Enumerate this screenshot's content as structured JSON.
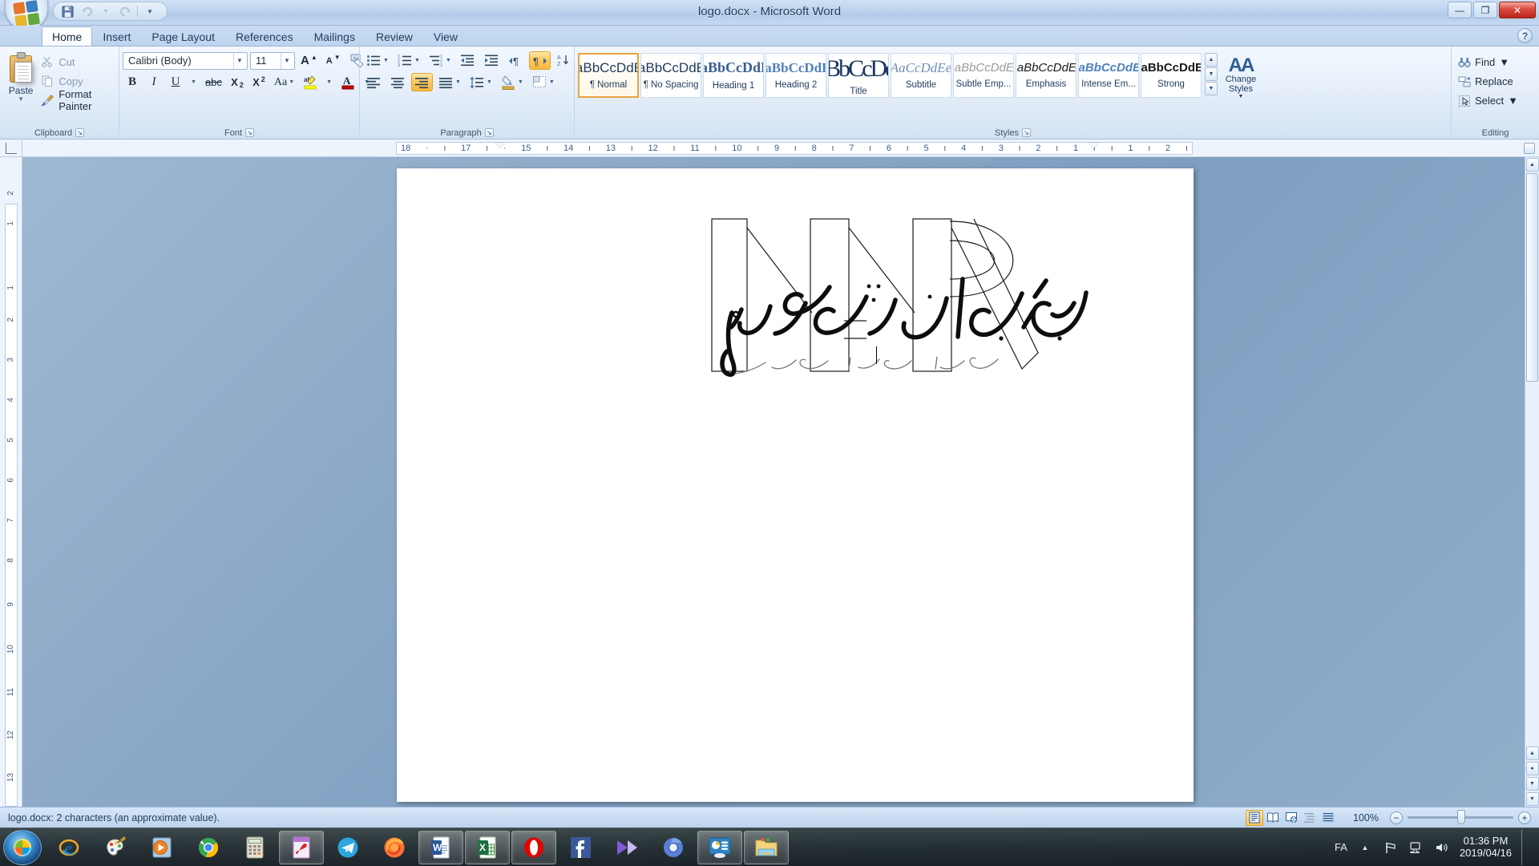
{
  "window": {
    "title": "logo.docx - Microsoft Word",
    "office_button": "office-orb",
    "quick_access": [
      {
        "name": "save",
        "icon": "save-icon",
        "label": "Save"
      },
      {
        "name": "undo",
        "icon": "undo-icon",
        "label": "Undo"
      },
      {
        "name": "undo-dropdown",
        "icon": "chevron-down-icon",
        "label": ""
      },
      {
        "name": "redo",
        "icon": "redo-icon",
        "label": "Redo"
      },
      {
        "name": "customize",
        "icon": "chevron-down-icon",
        "label": ""
      }
    ],
    "controls": [
      {
        "name": "minimize",
        "glyph": "—"
      },
      {
        "name": "maximize",
        "glyph": "❐"
      },
      {
        "name": "close",
        "glyph": "✕"
      }
    ],
    "help_glyph": "?"
  },
  "tabs": [
    {
      "label": "Home",
      "active": true
    },
    {
      "label": "Insert",
      "active": false
    },
    {
      "label": "Page Layout",
      "active": false
    },
    {
      "label": "References",
      "active": false
    },
    {
      "label": "Mailings",
      "active": false
    },
    {
      "label": "Review",
      "active": false
    },
    {
      "label": "View",
      "active": false
    }
  ],
  "ribbon": {
    "clipboard": {
      "label": "Clipboard",
      "paste_label": "Paste",
      "items": [
        {
          "label": "Cut",
          "icon": "scissors-icon",
          "enabled": false
        },
        {
          "label": "Copy",
          "icon": "copy-icon",
          "enabled": false
        },
        {
          "label": "Format Painter",
          "icon": "paintbrush-icon",
          "enabled": true
        }
      ]
    },
    "font": {
      "label": "Font",
      "font_name": "Calibri (Body)",
      "font_size": "11",
      "buttons": [
        {
          "name": "grow-font",
          "glyph": "A",
          "label": "Grow Font"
        },
        {
          "name": "shrink-font",
          "glyph": "A",
          "label": "Shrink Font"
        },
        {
          "name": "clear-formatting",
          "glyph": "Aa",
          "label": "Clear Formatting"
        },
        {
          "name": "bold",
          "glyph": "B",
          "label": "Bold"
        },
        {
          "name": "italic",
          "glyph": "I",
          "label": "Italic"
        },
        {
          "name": "underline",
          "glyph": "U",
          "label": "Underline"
        },
        {
          "name": "strikethrough",
          "glyph": "abc",
          "label": "Strikethrough"
        },
        {
          "name": "subscript",
          "glyph": "X₂",
          "label": "Subscript"
        },
        {
          "name": "superscript",
          "glyph": "X²",
          "label": "Superscript"
        },
        {
          "name": "change-case",
          "glyph": "Aa",
          "label": "Change Case"
        },
        {
          "name": "text-highlight-color",
          "glyph": "ab",
          "label": "Text Highlight Color",
          "color": "#ffff00"
        },
        {
          "name": "font-color",
          "glyph": "A",
          "label": "Font Color",
          "color": "#c00000"
        }
      ]
    },
    "paragraph": {
      "label": "Paragraph",
      "buttons": [
        {
          "name": "bullets",
          "label": "Bullets"
        },
        {
          "name": "numbering",
          "label": "Numbering"
        },
        {
          "name": "multilevel-list",
          "label": "Multilevel List"
        },
        {
          "name": "decrease-indent",
          "label": "Decrease Indent"
        },
        {
          "name": "increase-indent",
          "label": "Increase Indent"
        },
        {
          "name": "ltr-text-direction",
          "label": "Left-to-Right Text Direction"
        },
        {
          "name": "rtl-text-direction",
          "label": "Right-to-Left Text Direction",
          "active": true
        },
        {
          "name": "sort",
          "label": "Sort"
        },
        {
          "name": "show-formatting-marks",
          "label": "Show/Hide ¶",
          "glyph": "¶"
        },
        {
          "name": "align-left",
          "label": "Align Text Left"
        },
        {
          "name": "center",
          "label": "Center"
        },
        {
          "name": "align-right",
          "label": "Align Text Right",
          "active": true
        },
        {
          "name": "justify",
          "label": "Justify"
        },
        {
          "name": "line-spacing",
          "label": "Line Spacing"
        },
        {
          "name": "shading",
          "label": "Shading"
        },
        {
          "name": "borders",
          "label": "Borders"
        }
      ]
    },
    "styles": {
      "label": "Styles",
      "gallery": [
        {
          "preview": "AaBbCcDdEe",
          "name": "¶ Normal",
          "selected": true,
          "style": "normal"
        },
        {
          "preview": "AaBbCcDdEe",
          "name": "¶ No Spacing",
          "selected": false,
          "style": "normal"
        },
        {
          "preview": "AaBbCcDdEe",
          "name": "Heading 1",
          "selected": false,
          "style": "heading1"
        },
        {
          "preview": "AaBbCcDdEe",
          "name": "Heading 2",
          "selected": false,
          "style": "heading2"
        },
        {
          "preview": "AaBbCcDdEe",
          "name": "Title",
          "selected": false,
          "style": "title"
        },
        {
          "preview": "AaCcDdEe",
          "name": "Subtitle",
          "selected": false,
          "style": "subtitle"
        },
        {
          "preview": "AaBbCcDdEe",
          "name": "Subtle Emp...",
          "selected": false,
          "style": "subtle-emphasis"
        },
        {
          "preview": "AaBbCcDdEe",
          "name": "Emphasis",
          "selected": false,
          "style": "emphasis"
        },
        {
          "preview": "AaBbCcDdEe",
          "name": "Intense Em...",
          "selected": false,
          "style": "intense-emphasis"
        },
        {
          "preview": "AaBbCcDdEe",
          "name": "Strong",
          "selected": false,
          "style": "strong"
        }
      ],
      "change_styles_line1": "Change",
      "change_styles_line2": "Styles",
      "change_styles_icon": "AA"
    },
    "editing": {
      "label": "Editing",
      "items": [
        {
          "label": "Find",
          "icon": "binoculars-icon",
          "has_caret": true
        },
        {
          "label": "Replace",
          "icon": "replace-icon",
          "has_caret": false
        },
        {
          "label": "Select",
          "icon": "select-icon",
          "has_caret": true
        }
      ]
    }
  },
  "ruler": {
    "horizontal_ticks": [
      "18",
      "17",
      "16",
      "15",
      "14",
      "13",
      "12",
      "11",
      "10",
      "9",
      "8",
      "7",
      "6",
      "5",
      "4",
      "3",
      "2",
      "1",
      "",
      "1",
      "2"
    ],
    "vertical_ticks": [
      "2",
      "1",
      "",
      "1",
      "2",
      "3",
      "4",
      "5",
      "6",
      "7",
      "8",
      "9",
      "10",
      "11",
      "12",
      "13"
    ]
  },
  "document": {
    "filename": "logo.docx",
    "logo_alt": "NNP monogram with Persian calligraphy",
    "calligraphy_line": "نیکو اندیشان رسام",
    "monogram_letters": [
      "N",
      "N",
      "P"
    ]
  },
  "statusbar": {
    "text": "logo.docx: 2 characters (an approximate value).",
    "view_buttons": [
      {
        "name": "print-layout",
        "active": true
      },
      {
        "name": "full-screen-reading",
        "active": false
      },
      {
        "name": "web-layout",
        "active": false
      },
      {
        "name": "outline",
        "active": false
      },
      {
        "name": "draft",
        "active": false
      }
    ],
    "zoom_level": "100%",
    "zoom_out_glyph": "−",
    "zoom_in_glyph": "+"
  },
  "taskbar": {
    "start_label": "Start",
    "items": [
      {
        "name": "internet-explorer",
        "label": "Internet Explorer",
        "running": false
      },
      {
        "name": "paint",
        "label": "Paint",
        "running": false
      },
      {
        "name": "windows-media-player",
        "label": "Windows Media Player",
        "running": false
      },
      {
        "name": "google-chrome",
        "label": "Google Chrome",
        "running": false
      },
      {
        "name": "calculator",
        "label": "Calculator",
        "running": false
      },
      {
        "name": "adobe-acrobat",
        "label": "Adobe Acrobat",
        "running": true
      },
      {
        "name": "telegram",
        "label": "Telegram",
        "running": false
      },
      {
        "name": "firefox",
        "label": "Mozilla Firefox",
        "running": false
      },
      {
        "name": "microsoft-word",
        "label": "Microsoft Word",
        "running": true
      },
      {
        "name": "microsoft-excel",
        "label": "Microsoft Excel",
        "running": true
      },
      {
        "name": "opera",
        "label": "Opera",
        "running": true
      },
      {
        "name": "facebook",
        "label": "Facebook",
        "running": false
      },
      {
        "name": "media-player-classic",
        "label": "Media Player",
        "running": false
      },
      {
        "name": "chromium",
        "label": "Chromium",
        "running": false
      },
      {
        "name": "control-panel",
        "label": "Control Panel",
        "running": true
      },
      {
        "name": "windows-explorer",
        "label": "Windows Explorer",
        "running": true
      }
    ],
    "tray": {
      "language": "FA",
      "show_hidden_glyph": "▲",
      "icons": [
        {
          "name": "action-center-flag-icon"
        },
        {
          "name": "network-icon"
        },
        {
          "name": "volume-icon"
        }
      ],
      "time": "01:36 PM",
      "date": "2019/04/16"
    }
  }
}
